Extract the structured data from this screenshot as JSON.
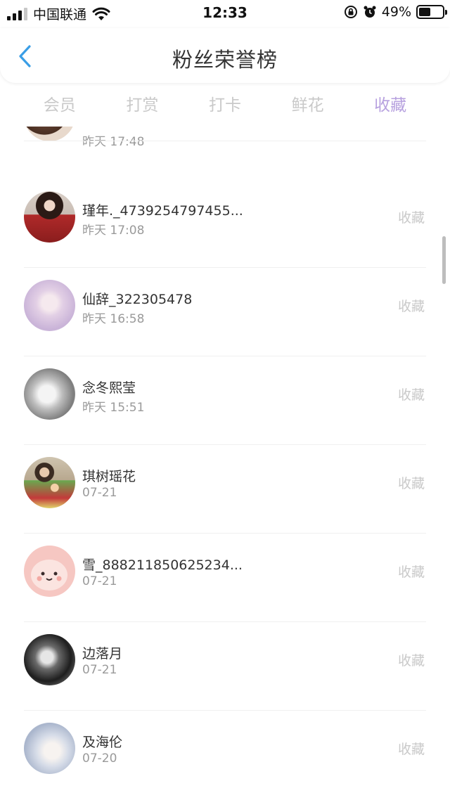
{
  "status_bar": {
    "carrier": "中国联通",
    "time": "12:33",
    "battery_percent": "49%",
    "battery_level": 0.49
  },
  "header": {
    "title": "粉丝荣誉榜"
  },
  "tabs": [
    {
      "label": "会员",
      "active": false
    },
    {
      "label": "打赏",
      "active": false
    },
    {
      "label": "打卡",
      "active": false
    },
    {
      "label": "鲜花",
      "active": false
    },
    {
      "label": "收藏",
      "active": true
    }
  ],
  "colors": {
    "active_tab": "#b7a1df",
    "inactive_tab": "#c9c9c9",
    "time_text": "#9a9a9a"
  },
  "list": {
    "partial_top_time": "昨天 17:48",
    "items": [
      {
        "name": "瑾年._4739254797455...",
        "time": "昨天 17:08",
        "action": "收藏",
        "avatar": "avatar-woman-red-coat"
      },
      {
        "name": "仙辞_322305478",
        "time": "昨天 16:58",
        "action": "收藏",
        "avatar": "avatar-pastel-anime-girl"
      },
      {
        "name": "念冬熙莹",
        "time": "昨天 15:51",
        "action": "收藏",
        "avatar": "avatar-grey-anime-girl"
      },
      {
        "name": "琪树瑶花",
        "time": "07-21",
        "action": "收藏",
        "avatar": "avatar-mother-child-photo"
      },
      {
        "name": "雪_888211850625234...",
        "time": "07-21",
        "action": "收藏",
        "avatar": "avatar-pink-cartoon"
      },
      {
        "name": "边落月",
        "time": "07-21",
        "action": "收藏",
        "avatar": "avatar-dark-anime"
      },
      {
        "name": "及海伦",
        "time": "07-20",
        "action": "收藏",
        "avatar": "avatar-light-anime-girl"
      }
    ]
  }
}
